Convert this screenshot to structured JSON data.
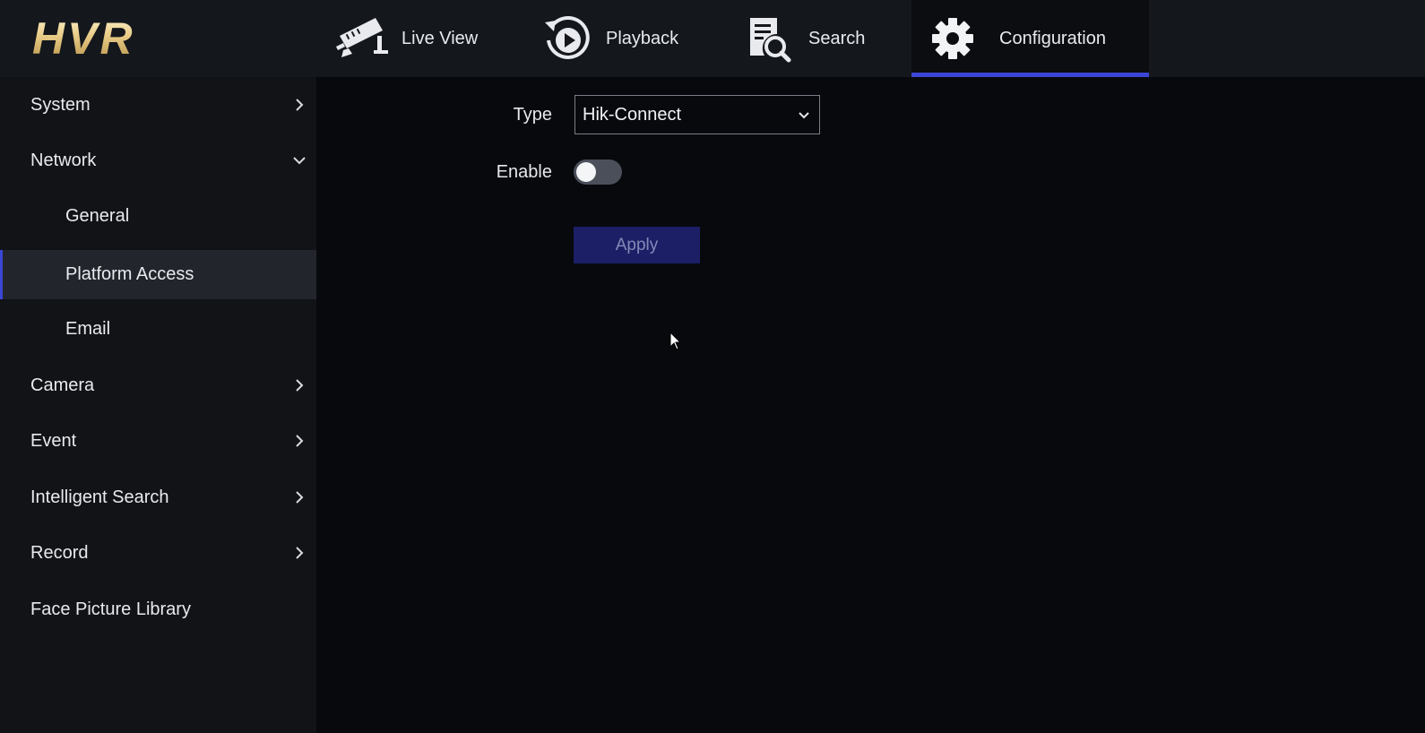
{
  "app": {
    "logo_text": "HVR"
  },
  "nav": {
    "tabs": [
      {
        "label": "Live View",
        "icon": "camera-icon",
        "active": false
      },
      {
        "label": "Playback",
        "icon": "playback-icon",
        "active": false
      },
      {
        "label": "Search",
        "icon": "search-icon",
        "active": false
      },
      {
        "label": "Configuration",
        "icon": "gear-icon",
        "active": true
      }
    ]
  },
  "sidebar": {
    "items": [
      {
        "label": "System",
        "chevron": "right"
      },
      {
        "label": "Network",
        "chevron": "down"
      },
      {
        "label": "General",
        "sub": true
      },
      {
        "label": "Platform Access",
        "sub": true,
        "selected": true
      },
      {
        "label": "Email",
        "sub": true
      },
      {
        "label": "Camera",
        "chevron": "right"
      },
      {
        "label": "Event",
        "chevron": "right"
      },
      {
        "label": "Intelligent Search",
        "chevron": "right"
      },
      {
        "label": "Record",
        "chevron": "right"
      },
      {
        "label": "Face Picture Library"
      }
    ]
  },
  "form": {
    "type_label": "Type",
    "type_value": "Hik-Connect",
    "enable_label": "Enable",
    "enable_on": false,
    "apply_label": "Apply"
  },
  "colors": {
    "accent": "#3b46d6",
    "topbar_bg": "#14171c",
    "sidebar_bg": "#111317",
    "main_bg": "#07090d",
    "apply_bg": "#1c1f66"
  }
}
